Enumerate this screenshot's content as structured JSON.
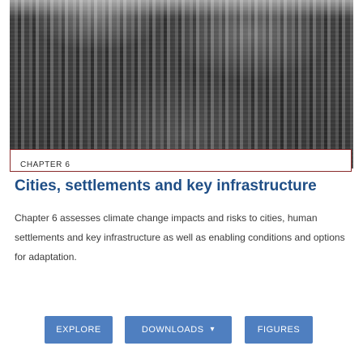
{
  "hero": {
    "image_alt": "City aerial view"
  },
  "chapter": {
    "label": "CHAPTER 6",
    "title": "Cities, settlements and key infrastructure",
    "description": "Chapter 6 assesses climate change impacts and risks to cities, human settlements and key infrastructure as well as enabling conditions and options for adaptation."
  },
  "buttons": {
    "explore": "EXPLORE",
    "downloads": "DOWNLOADS",
    "figures": "FIGURES"
  },
  "colors": {
    "title": "#1f4e86",
    "button_bg": "#4f7fc0",
    "border_accent": "#8a2a2a"
  },
  "icons": {
    "downloads_caret": "caret-down-icon"
  }
}
